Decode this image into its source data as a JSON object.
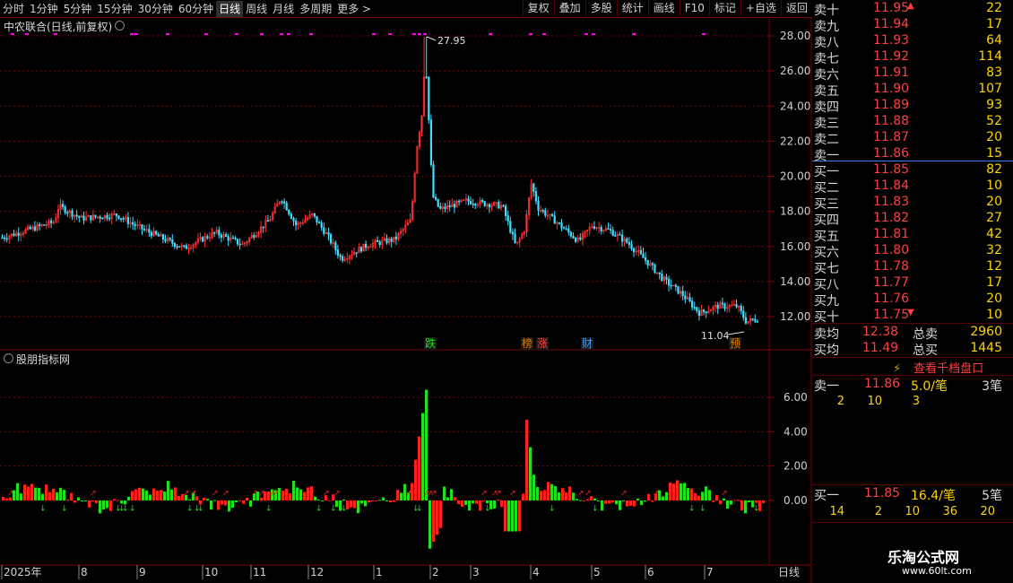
{
  "toolbar": {
    "periods": [
      "分时",
      "1分钟",
      "5分钟",
      "15分钟",
      "30分钟",
      "60分钟",
      "日线",
      "周线",
      "月线",
      "多周期",
      "更多 >"
    ],
    "active_period": "日线",
    "tools": [
      "复权",
      "叠加",
      "多股",
      "统计",
      "画线",
      "F10",
      "标记",
      "+自选",
      "返回"
    ]
  },
  "main_chart": {
    "title": "中农联合(日线,前复权)",
    "high_label": "27.95",
    "low_label": "11.04",
    "y_ticks": [
      "28.00",
      "26.00",
      "24.00",
      "22.00",
      "20.00",
      "18.00",
      "16.00",
      "14.00",
      "12.00"
    ],
    "event_tags": [
      {
        "text": "跌",
        "color": "#20e020"
      },
      {
        "text": "榜",
        "color": "#e08000"
      },
      {
        "text": "涨",
        "color": "#ff4040"
      },
      {
        "text": "财",
        "color": "#40a0ff"
      },
      {
        "text": "预",
        "color": "#e08000"
      }
    ]
  },
  "sub_chart": {
    "title": "股朋指标网",
    "y_ticks": [
      "6.00",
      "4.00",
      "2.00",
      "0.00"
    ]
  },
  "x_axis": {
    "labels": [
      "2025年",
      "8",
      "9",
      "10",
      "11",
      "12",
      "1",
      "2",
      "3",
      "4",
      "5",
      "6",
      "7"
    ],
    "period_label": "日线"
  },
  "orderbook": {
    "asks": [
      {
        "label": "卖十",
        "price": "11.95",
        "vol": "22",
        "mark": "▲"
      },
      {
        "label": "卖九",
        "price": "11.94",
        "vol": "17"
      },
      {
        "label": "卖八",
        "price": "11.93",
        "vol": "64"
      },
      {
        "label": "卖七",
        "price": "11.92",
        "vol": "114"
      },
      {
        "label": "卖六",
        "price": "11.91",
        "vol": "83"
      },
      {
        "label": "卖五",
        "price": "11.90",
        "vol": "107"
      },
      {
        "label": "卖四",
        "price": "11.89",
        "vol": "93"
      },
      {
        "label": "卖三",
        "price": "11.88",
        "vol": "52"
      },
      {
        "label": "卖二",
        "price": "11.87",
        "vol": "20"
      },
      {
        "label": "卖一",
        "price": "11.86",
        "vol": "15"
      }
    ],
    "bids": [
      {
        "label": "买一",
        "price": "11.85",
        "vol": "82"
      },
      {
        "label": "买二",
        "price": "11.84",
        "vol": "10"
      },
      {
        "label": "买三",
        "price": "11.83",
        "vol": "20"
      },
      {
        "label": "买四",
        "price": "11.82",
        "vol": "27"
      },
      {
        "label": "买五",
        "price": "11.81",
        "vol": "42"
      },
      {
        "label": "买六",
        "price": "11.80",
        "vol": "32"
      },
      {
        "label": "买七",
        "price": "11.78",
        "vol": "12"
      },
      {
        "label": "买八",
        "price": "11.77",
        "vol": "17"
      },
      {
        "label": "买九",
        "price": "11.76",
        "vol": "20"
      },
      {
        "label": "买十",
        "price": "11.75",
        "vol": "10",
        "mark": "▼"
      }
    ],
    "sell_avg_label": "卖均",
    "sell_avg": "12.38",
    "total_sell_label": "总卖",
    "total_sell": "2960",
    "buy_avg_label": "买均",
    "buy_avg": "11.49",
    "total_buy_label": "总买",
    "total_buy": "1445",
    "view_link": "查看千档盘口",
    "ask1": {
      "label": "卖一",
      "price": "11.86",
      "per": "5.0/笔",
      "count": "3笔",
      "orders": [
        "2",
        "10",
        "3"
      ]
    },
    "bid1": {
      "label": "买一",
      "price": "11.85",
      "per": "16.4/笔",
      "count": "5笔",
      "orders": [
        "14",
        "2",
        "10",
        "36",
        "20"
      ]
    }
  },
  "watermark": {
    "name": "乐淘公式网",
    "url": "www.60lt.com"
  },
  "colors": {
    "up": "#ff3030",
    "down": "#40e0ff",
    "grid": "#7a0000",
    "signal_up": "#ff2020",
    "signal_down": "#20e020",
    "dot": "#ff00ff"
  }
}
